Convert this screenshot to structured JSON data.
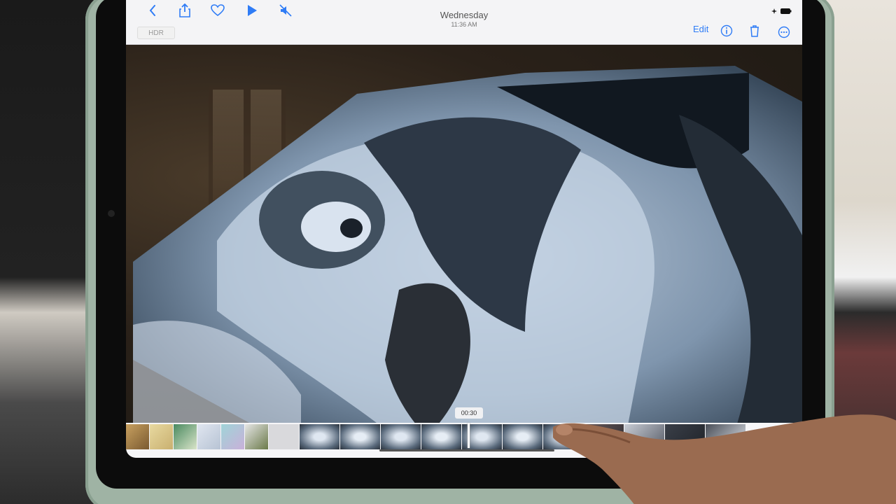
{
  "toolbar": {
    "back_icon": "chevron-left-icon",
    "share_icon": "share-icon",
    "favorite_icon": "heart-icon",
    "play_icon": "play-icon",
    "mute_icon": "speaker-muted-icon",
    "title": "Wednesday",
    "subtitle": "11:36 AM",
    "edit_label": "Edit",
    "info_icon": "info-icon",
    "delete_icon": "trash-icon",
    "more_icon": "ellipsis-icon"
  },
  "badge": {
    "hdr_label": "HDR"
  },
  "timeline": {
    "current_time": "00:30"
  },
  "colors": {
    "accent": "#2f7cf6",
    "toolbar_bg": "#f4f4f6"
  }
}
